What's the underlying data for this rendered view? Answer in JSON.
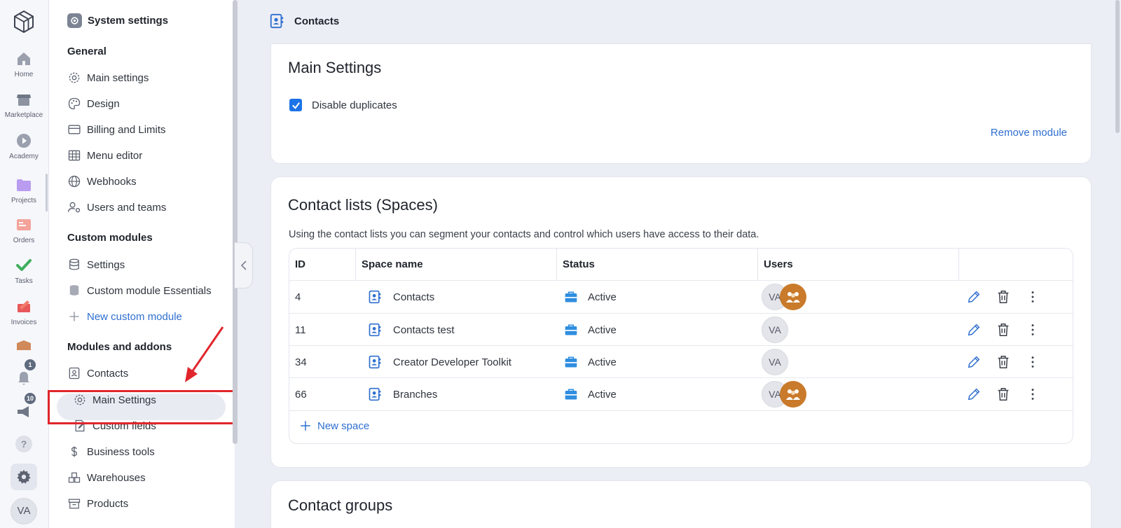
{
  "rail": {
    "items": [
      {
        "label": "Home"
      },
      {
        "label": "Marketplace"
      },
      {
        "label": "Academy"
      },
      {
        "label": "Projects"
      },
      {
        "label": "Orders"
      },
      {
        "label": "Tasks"
      },
      {
        "label": "Invoices"
      }
    ],
    "notifications_count": "1",
    "announcements_count": "10",
    "help_label": "?",
    "avatar_initials": "VA"
  },
  "sidebar": {
    "title": "System settings",
    "general": {
      "heading": "General",
      "items": [
        "Main settings",
        "Design",
        "Billing and Limits",
        "Menu editor",
        "Webhooks",
        "Users and teams"
      ]
    },
    "custom_modules": {
      "heading": "Custom modules",
      "items": [
        "Settings",
        "Custom module Essentials"
      ],
      "new_label": "New custom module"
    },
    "modules": {
      "heading": "Modules and addons",
      "contacts": "Contacts",
      "main_settings": "Main Settings",
      "custom_fields": "Custom fields",
      "business_tools": "Business tools",
      "warehouses": "Warehouses",
      "products": "Products"
    }
  },
  "main": {
    "breadcrumb": "Contacts",
    "main_settings": {
      "title": "Main Settings",
      "disable_duplicates_label": "Disable duplicates",
      "disable_duplicates_checked": true,
      "remove_module_label": "Remove module"
    },
    "contact_lists": {
      "title": "Contact lists (Spaces)",
      "description": "Using the contact lists you can segment your contacts and control which users have access to their data.",
      "columns": [
        "ID",
        "Space name",
        "Status",
        "Users",
        ""
      ],
      "rows": [
        {
          "id": "4",
          "name": "Contacts",
          "status": "Active",
          "users": "VA",
          "group_avatar": true
        },
        {
          "id": "11",
          "name": "Contacts test",
          "status": "Active",
          "users": "VA",
          "group_avatar": false
        },
        {
          "id": "34",
          "name": "Creator Developer Toolkit",
          "status": "Active",
          "users": "VA",
          "group_avatar": false
        },
        {
          "id": "66",
          "name": "Branches",
          "status": "Active",
          "users": "VA",
          "group_avatar": true
        }
      ],
      "new_space_label": "New space"
    },
    "contact_groups": {
      "title": "Contact groups"
    }
  },
  "colors": {
    "accent": "#2f6fd0",
    "highlight": "#e0262c",
    "checkbox": "#1c73e8"
  }
}
